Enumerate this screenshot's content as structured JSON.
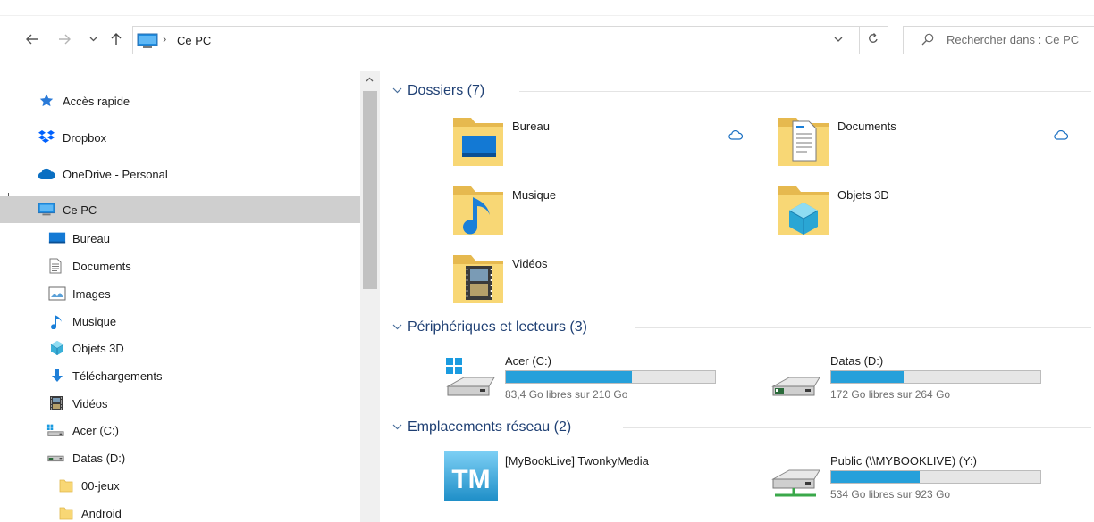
{
  "address": {
    "crumb": "Ce PC",
    "search_placeholder": "Rechercher dans : Ce PC"
  },
  "icons": {
    "back": "arrow-left-icon",
    "forward": "arrow-right-icon",
    "recent": "chevron-down-icon",
    "up": "arrow-up-icon",
    "refresh": "refresh-icon",
    "search": "search-icon"
  },
  "sidebar": {
    "items": [
      {
        "label": "Accès rapide",
        "icon": "star-icon"
      },
      {
        "label": "Dropbox",
        "icon": "dropbox-icon"
      },
      {
        "label": "OneDrive - Personal",
        "icon": "cloud-icon"
      },
      {
        "label": "Ce PC",
        "icon": "computer-icon",
        "selected": true
      },
      {
        "label": "Bureau",
        "icon": "desktop-icon"
      },
      {
        "label": "Documents",
        "icon": "document-icon"
      },
      {
        "label": "Images",
        "icon": "image-icon"
      },
      {
        "label": "Musique",
        "icon": "music-note-icon"
      },
      {
        "label": "Objets 3D",
        "icon": "cube-icon"
      },
      {
        "label": "Téléchargements",
        "icon": "download-icon"
      },
      {
        "label": "Vidéos",
        "icon": "video-icon"
      },
      {
        "label": "Acer (C:)",
        "icon": "drive-windows-icon"
      },
      {
        "label": "Datas (D:)",
        "icon": "drive-icon"
      },
      {
        "label": "00-jeux",
        "icon": "folder-icon"
      },
      {
        "label": "Android",
        "icon": "folder-icon"
      }
    ]
  },
  "groups": {
    "folders": {
      "title": "Dossiers (7)",
      "items": [
        {
          "name": "Bureau",
          "icon": "folder-desktop-icon",
          "cloud": true
        },
        {
          "name": "Documents",
          "icon": "folder-documents-icon",
          "cloud": true
        },
        {
          "name": "Musique",
          "icon": "folder-music-icon"
        },
        {
          "name": "Objets 3D",
          "icon": "folder-3d-icon"
        },
        {
          "name": "Vidéos",
          "icon": "folder-video-icon"
        }
      ]
    },
    "drives": {
      "title": "Périphériques et lecteurs (3)",
      "items": [
        {
          "name": "Acer (C:)",
          "free": "83,4 Go libres sur 210 Go",
          "used_fraction": 0.603,
          "icon": "drive-windows-icon"
        },
        {
          "name": "Datas (D:)",
          "free": "172 Go libres sur 264 Go",
          "used_fraction": 0.348,
          "icon": "drive-icon"
        }
      ]
    },
    "network": {
      "title": "Emplacements réseau (2)",
      "items": [
        {
          "name": "[MyBookLive] TwonkyMedia",
          "icon": "twonky-media-icon",
          "logo_text": "TM"
        },
        {
          "name": "Public (\\\\MYBOOKLIVE) (Y:)",
          "free": "534 Go libres sur 923 Go",
          "used_fraction": 0.421,
          "icon": "network-drive-icon"
        }
      ]
    }
  },
  "colors": {
    "accent": "#26a0da",
    "group_title": "#1e3f73",
    "selection": "#cfcfcf",
    "folder": "#f8d775",
    "cloud": "#0a6fc2"
  }
}
